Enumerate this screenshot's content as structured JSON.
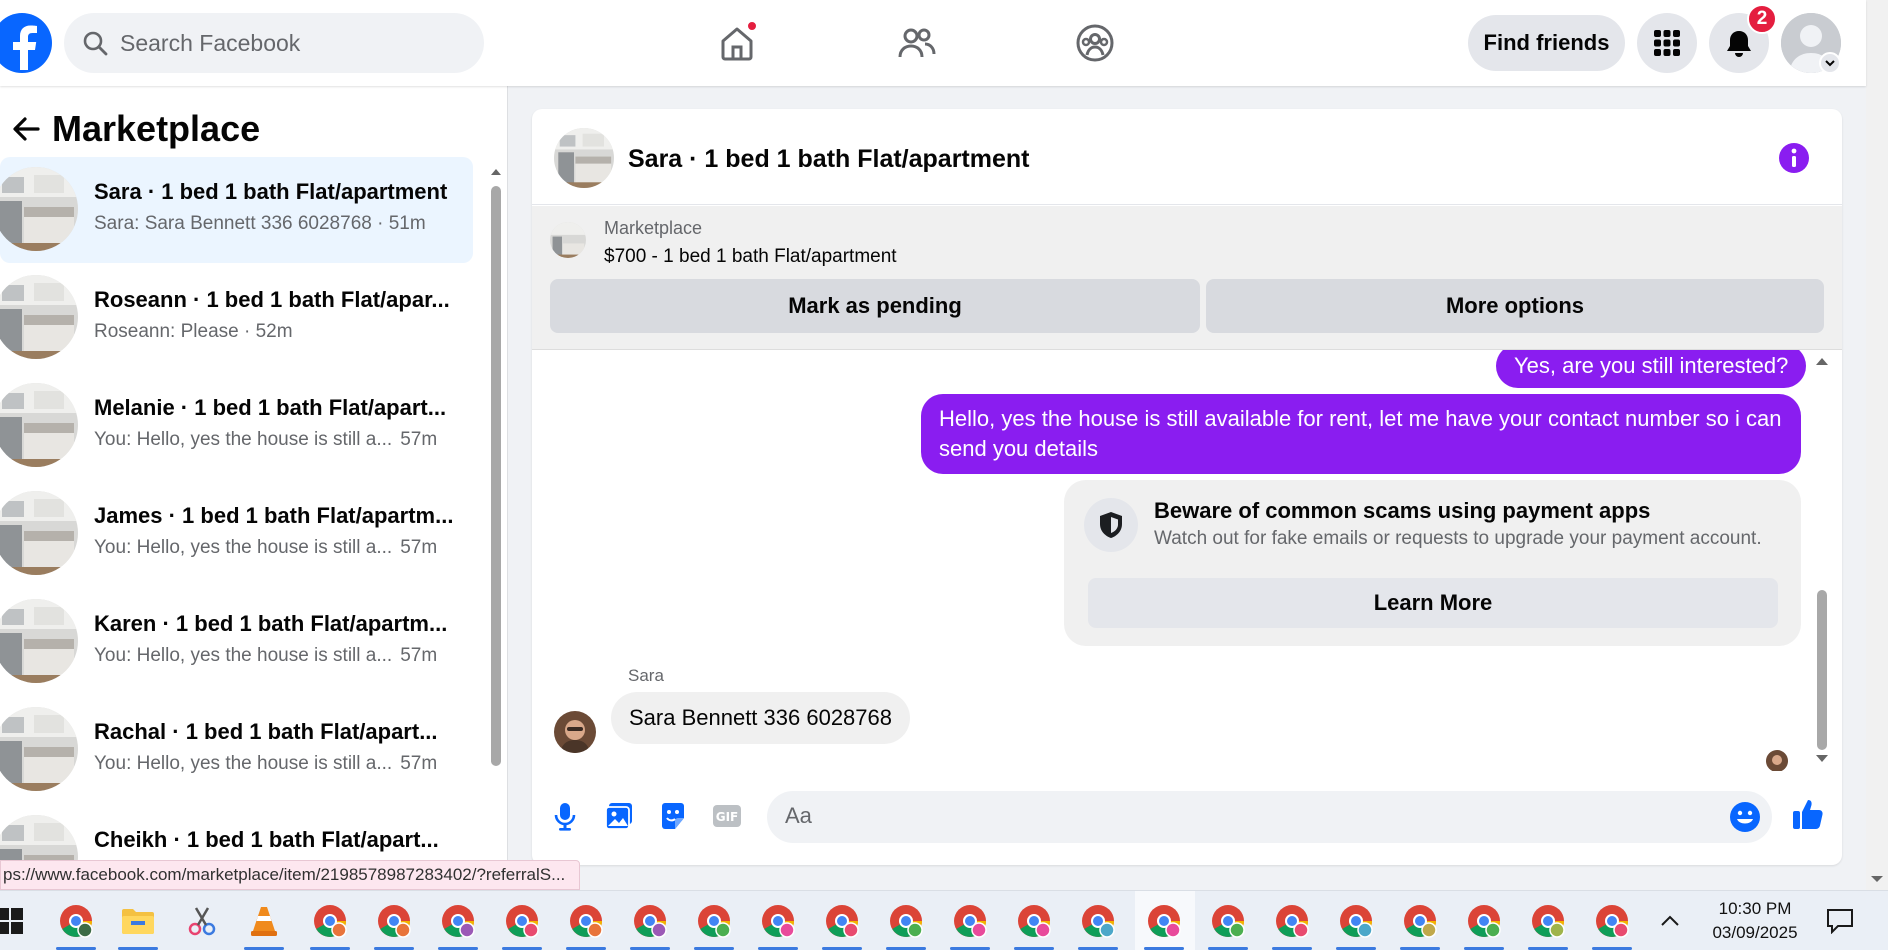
{
  "topbar": {
    "search_placeholder": "Search Facebook",
    "find_friends": "Find friends",
    "notif_count": "2"
  },
  "left": {
    "title": "Marketplace",
    "conversations": [
      {
        "title": "Sara · 1 bed 1 bath Flat/apartment",
        "preview": "Sara: Sara Bennett 336 6028768 · 51m",
        "time": ""
      },
      {
        "title": "Roseann · 1 bed 1 bath Flat/apar...",
        "preview": "Roseann: Please · 52m",
        "time": ""
      },
      {
        "title": "Melanie · 1 bed 1 bath Flat/apart...",
        "preview": "You: Hello, yes the house is still a...",
        "time": "57m"
      },
      {
        "title": "James · 1 bed 1 bath Flat/apartm...",
        "preview": "You: Hello, yes the house is still a...",
        "time": "57m"
      },
      {
        "title": "Karen · 1 bed 1 bath Flat/apartm...",
        "preview": "You: Hello, yes the house is still a...",
        "time": "57m"
      },
      {
        "title": "Rachal · 1 bed 1 bath Flat/apart...",
        "preview": "You: Hello, yes the house is still a...",
        "time": "57m"
      },
      {
        "title": "Cheikh · 1 bed 1 bath Flat/apart...",
        "preview": "",
        "time": ""
      }
    ]
  },
  "chat": {
    "title": "Sara · 1 bed 1 bath Flat/apartment",
    "listing_label": "Marketplace",
    "listing_title": "$700 - 1 bed 1 bath Flat/apartment",
    "mark_pending": "Mark as pending",
    "more_options": "More options",
    "messages": {
      "out1": "Yes, are you still interested?",
      "out2": "Hello, yes the house is still available for rent, let me have your contact number so i can send you details",
      "scam_title": "Beware of common scams using payment apps",
      "scam_desc": "Watch out for fake emails or requests to upgrade your payment account.",
      "learn_more": "Learn More",
      "sender_name": "Sara",
      "in1": "Sara Bennett 336 6028768"
    },
    "composer_placeholder": "Aa"
  },
  "status_url": "ps://www.facebook.com/marketplace/item/2198578987283402/?referralS...",
  "taskbar": {
    "time": "10:30 PM",
    "date": "03/09/2025"
  },
  "colors": {
    "brand": "#0866ff",
    "messenger_purple": "#8a1df0",
    "notification_red": "#e41e3f"
  }
}
